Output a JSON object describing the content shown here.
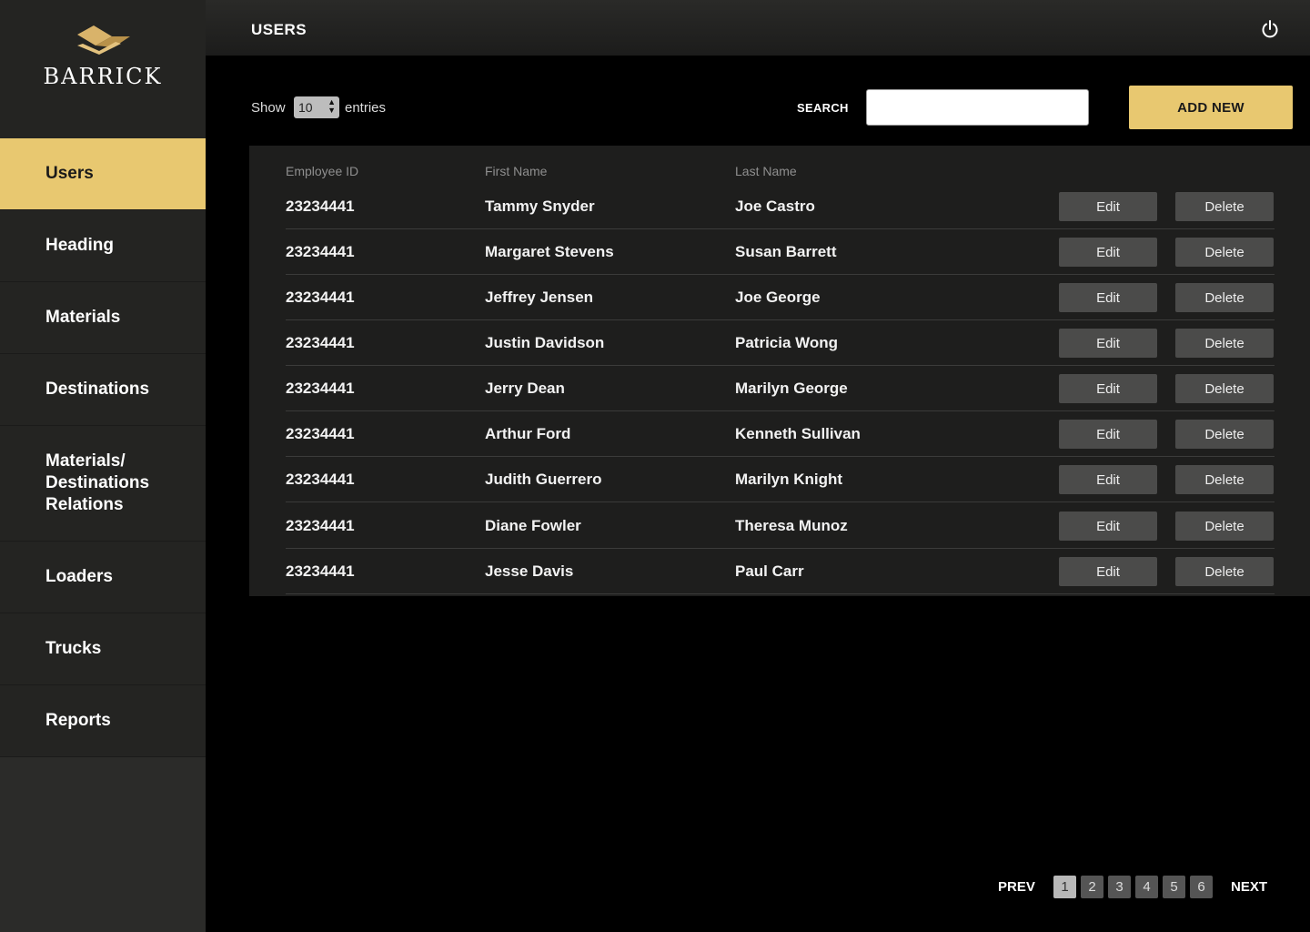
{
  "brand": {
    "logo_text": "BARRICK"
  },
  "sidebar": {
    "items": [
      {
        "label": "Users",
        "active": true
      },
      {
        "label": "Heading"
      },
      {
        "label": "Materials"
      },
      {
        "label": "Destinations"
      },
      {
        "label": "Materials/ Destinations Relations"
      },
      {
        "label": "Loaders"
      },
      {
        "label": "Trucks"
      },
      {
        "label": "Reports"
      }
    ]
  },
  "header": {
    "title": "USERS",
    "power_icon": "power-icon"
  },
  "controls": {
    "show_label": "Show",
    "entries_value": "10",
    "entries_label": "entries",
    "search_label": "SEARCH",
    "search_value": "",
    "add_new_label": "ADD NEW"
  },
  "table": {
    "columns": [
      "Employee ID",
      "First Name",
      "Last Name"
    ],
    "edit_label": "Edit",
    "delete_label": "Delete",
    "rows": [
      {
        "id": "23234441",
        "first": "Tammy Snyder",
        "last": "Joe Castro"
      },
      {
        "id": "23234441",
        "first": "Margaret Stevens",
        "last": "Susan Barrett"
      },
      {
        "id": "23234441",
        "first": "Jeffrey Jensen",
        "last": "Joe George"
      },
      {
        "id": "23234441",
        "first": "Justin Davidson",
        "last": "Patricia Wong"
      },
      {
        "id": "23234441",
        "first": "Jerry Dean",
        "last": "Marilyn George"
      },
      {
        "id": "23234441",
        "first": "Arthur Ford",
        "last": "Kenneth Sullivan"
      },
      {
        "id": "23234441",
        "first": "Judith Guerrero",
        "last": "Marilyn Knight"
      },
      {
        "id": "23234441",
        "first": "Diane Fowler",
        "last": "Theresa Munoz"
      },
      {
        "id": "23234441",
        "first": "Jesse Davis",
        "last": "Paul Carr"
      }
    ]
  },
  "pagination": {
    "prev_label": "PREV",
    "next_label": "NEXT",
    "pages": [
      "1",
      "2",
      "3",
      "4",
      "5",
      "6"
    ],
    "current": "1"
  },
  "colors": {
    "accent": "#e8c870",
    "sidebar": "#242422",
    "button": "#4b4b4a"
  }
}
